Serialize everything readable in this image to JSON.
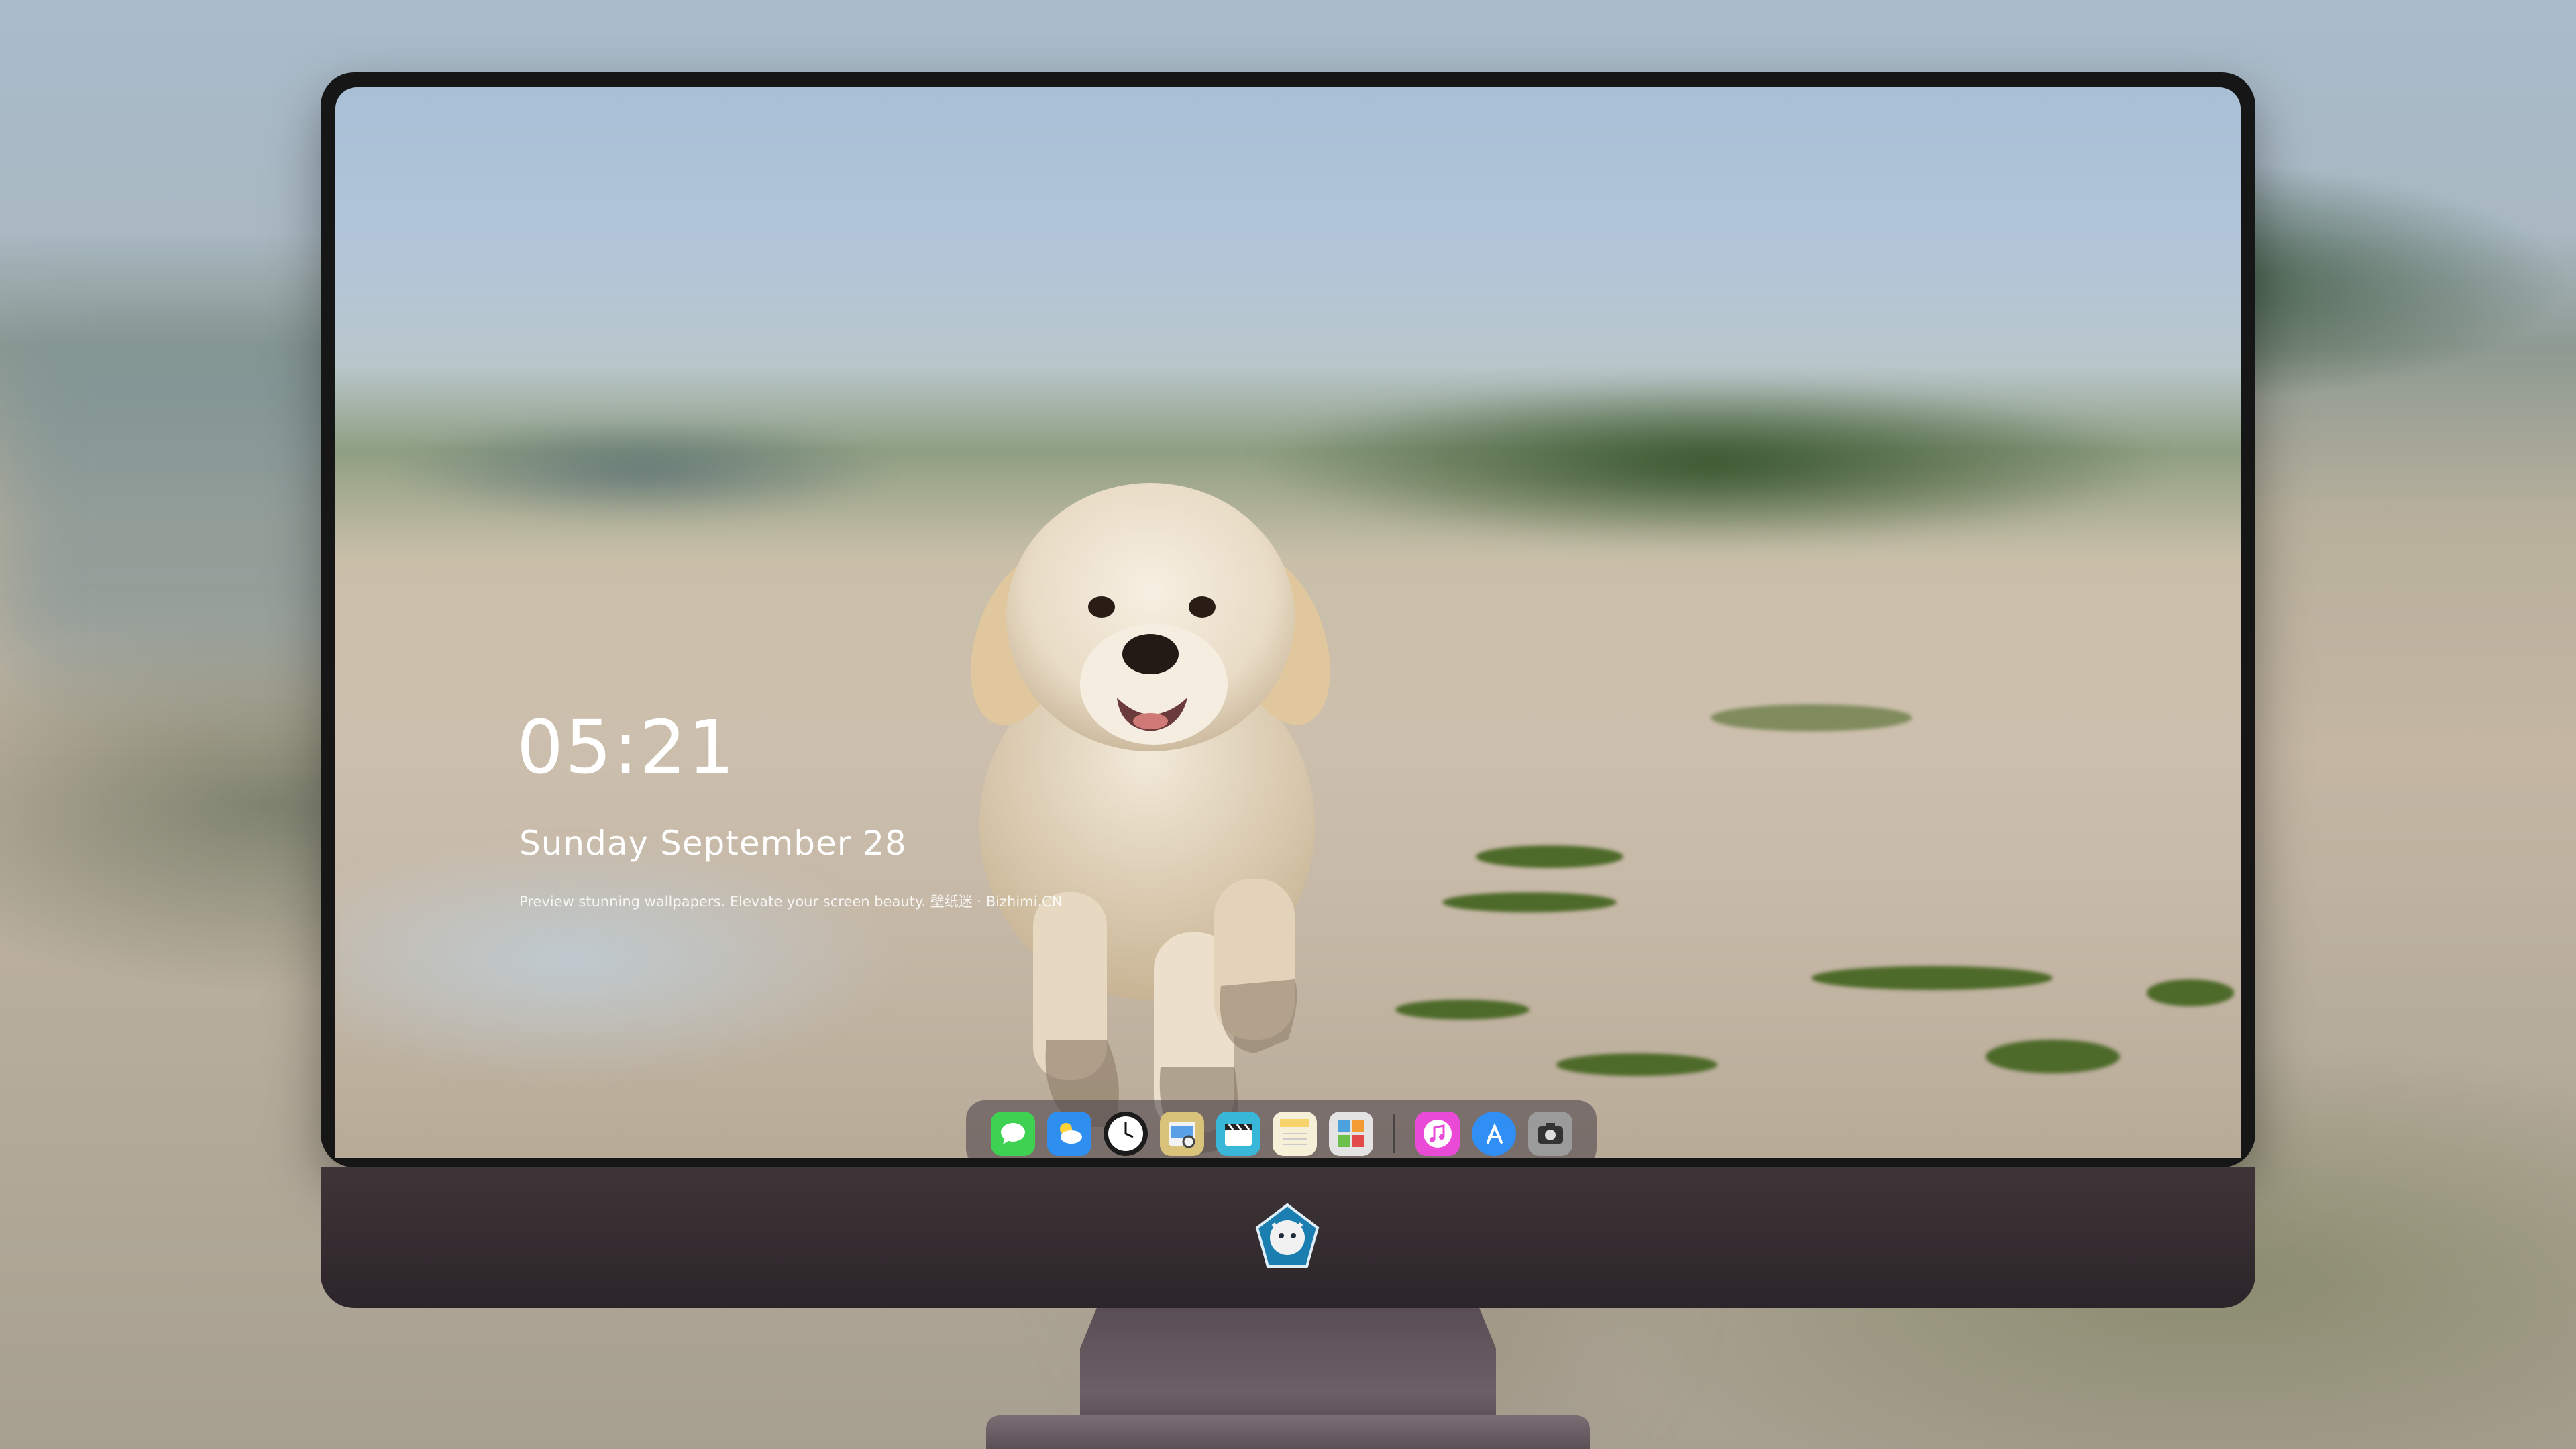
{
  "lock_screen": {
    "time": "05:21",
    "date": "Sunday September  28",
    "tagline": "Preview stunning wallpapers. Elevate your screen beauty. 壁纸迷 · Bizhimi.CN"
  },
  "dock": {
    "apps": [
      {
        "name": "Messages",
        "icon": "messages-icon",
        "color": "#3fd151"
      },
      {
        "name": "Weather",
        "icon": "weather-icon",
        "color": "#2e8ff0"
      },
      {
        "name": "Clock",
        "icon": "clock-icon",
        "color": "#1b1b1b"
      },
      {
        "name": "Preview",
        "icon": "preview-icon",
        "color": "#d9c27a"
      },
      {
        "name": "Final Cut",
        "icon": "clapper-icon",
        "color": "#39b7d9"
      },
      {
        "name": "Notes",
        "icon": "notes-icon",
        "color": "#f6d36b"
      },
      {
        "name": "Photo Booth",
        "icon": "photo-booth-icon",
        "color": "#e3e3e3"
      },
      {
        "name": "Music",
        "icon": "music-icon",
        "color": "#e94bd7"
      },
      {
        "name": "App Store",
        "icon": "app-store-icon",
        "color": "#2f8ff5"
      },
      {
        "name": "Camera",
        "icon": "camera-icon",
        "color": "#9b9b9b"
      }
    ]
  },
  "monitor": {
    "logo_icon": "cat-mascot-logo-icon"
  }
}
